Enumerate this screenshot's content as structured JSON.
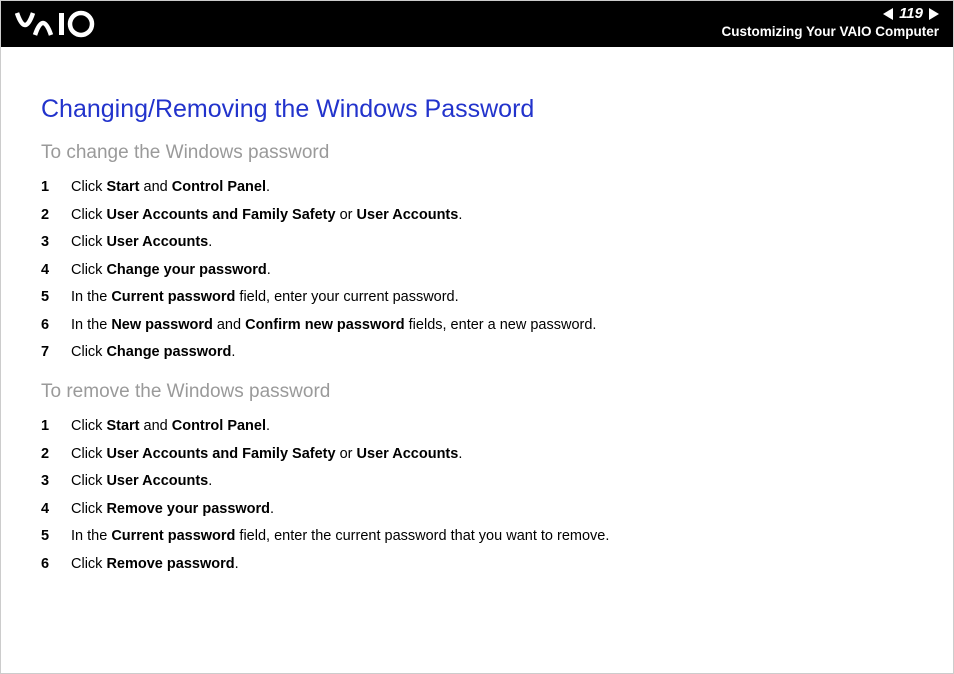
{
  "header": {
    "page_number": "119",
    "section": "Customizing Your VAIO Computer"
  },
  "title": "Changing/Removing the Windows Password",
  "sections": [
    {
      "heading": "To change the Windows password",
      "steps": [
        "Click <b>Start</b> and <b>Control Panel</b>.",
        "Click <b>User Accounts and Family Safety</b> or <b>User Accounts</b>.",
        "Click <b>User Accounts</b>.",
        "Click <b>Change your password</b>.",
        "In the <b>Current password</b> field, enter your current password.",
        "In the <b>New password</b> and <b>Confirm new password</b> fields, enter a new password.",
        "Click <b>Change password</b>."
      ]
    },
    {
      "heading": "To remove the Windows password",
      "steps": [
        "Click <b>Start</b> and <b>Control Panel</b>.",
        "Click <b>User Accounts and Family Safety</b> or <b>User Accounts</b>.",
        "Click <b>User Accounts</b>.",
        "Click <b>Remove your password</b>.",
        "In the <b>Current password</b> field, enter the current password that you want to remove.",
        "Click <b>Remove password</b>."
      ]
    }
  ]
}
